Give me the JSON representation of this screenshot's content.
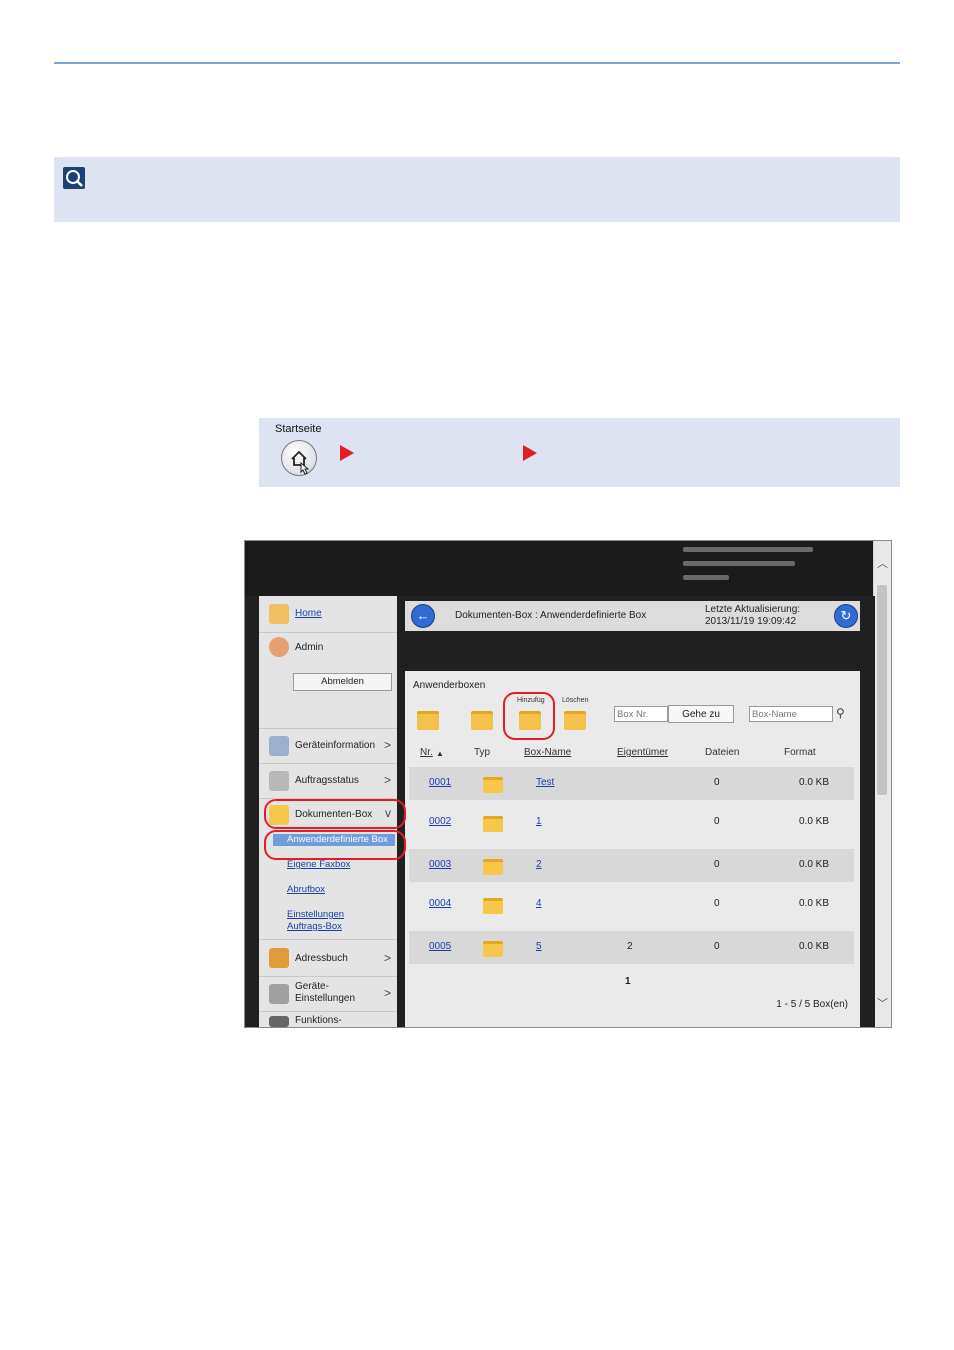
{
  "nav": {
    "start_label": "Startseite"
  },
  "screenshot": {
    "sidebar": {
      "home": "Home",
      "user": "Admin",
      "logout": "Abmelden",
      "items": [
        {
          "label": "Geräteinformation"
        },
        {
          "label": "Auftragsstatus"
        },
        {
          "label": "Dokumenten-Box"
        },
        {
          "label": "Adressbuch"
        },
        {
          "label": "Geräte-\nEinstellungen"
        },
        {
          "label": "Funktions-"
        }
      ],
      "subitems": [
        {
          "label": "Anwenderdefinierte Box"
        },
        {
          "label": "Eigene Faxbox"
        },
        {
          "label": "Abrufbox"
        },
        {
          "label": "Einstellungen Auftrags-Box"
        }
      ]
    },
    "breadcrumb": "Dokumenten-Box : Anwenderdefinierte Box",
    "last_update_label": "Letzte Aktualisierung:",
    "last_update_value": "2013/11/19 19:09:42",
    "panel_title": "Anwenderboxen",
    "toolbar": {
      "add_label": "Hinzufüg",
      "delete_label": "Löschen",
      "box_nr_placeholder": "Box Nr.",
      "goto_label": "Gehe zu",
      "box_name_placeholder": "Box-Name"
    },
    "columns": [
      "Nr.",
      "Typ",
      "Box-Name",
      "Eigentümer",
      "Dateien",
      "Format"
    ],
    "rows": [
      {
        "nr": "0001",
        "name": "Test",
        "owner": "",
        "files": "0",
        "format": "0.0 KB"
      },
      {
        "nr": "0002",
        "name": "1",
        "owner": "",
        "files": "0",
        "format": "0.0 KB"
      },
      {
        "nr": "0003",
        "name": "2",
        "owner": "",
        "files": "0",
        "format": "0.0 KB"
      },
      {
        "nr": "0004",
        "name": "4",
        "owner": "",
        "files": "0",
        "format": "0.0 KB"
      },
      {
        "nr": "0005",
        "name": "5",
        "owner": "2",
        "files": "0",
        "format": "0.0 KB"
      }
    ],
    "page": "1",
    "count": "1 - 5 / 5 Box(en)"
  }
}
